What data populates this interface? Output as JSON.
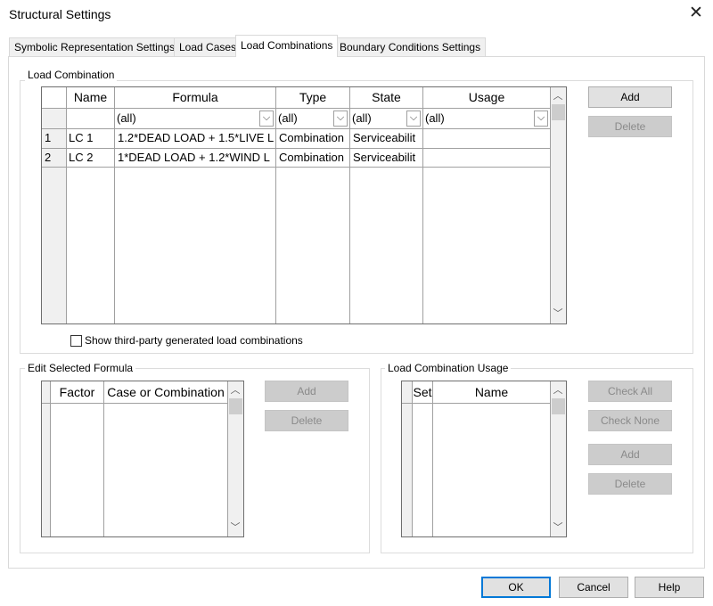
{
  "window": {
    "title": "Structural Settings"
  },
  "tabs": [
    {
      "label": "Symbolic Representation Settings"
    },
    {
      "label": "Load Cases"
    },
    {
      "label": "Load Combinations",
      "active": true
    },
    {
      "label": "Boundary Conditions Settings"
    }
  ],
  "load_combination": {
    "group_label": "Load Combination",
    "columns": [
      "Name",
      "Formula",
      "Type",
      "State",
      "Usage"
    ],
    "filter_value": "(all)",
    "rows": [
      {
        "num": "1",
        "name": "LC 1",
        "formula": "1.2*DEAD LOAD + 1.5*LIVE L",
        "type": "Combination",
        "state": "Serviceabilit",
        "usage": ""
      },
      {
        "num": "2",
        "name": "LC 2",
        "formula": "1*DEAD LOAD + 1.2*WIND L",
        "type": "Combination",
        "state": "Serviceabilit",
        "usage": ""
      }
    ],
    "add_label": "Add",
    "delete_label": "Delete",
    "show_third_party_label": "Show third-party generated load combinations",
    "show_third_party_checked": false
  },
  "edit_formula": {
    "group_label": "Edit Selected Formula",
    "columns": [
      "Factor",
      "Case or Combination"
    ],
    "add_label": "Add",
    "delete_label": "Delete"
  },
  "usage": {
    "group_label": "Load Combination Usage",
    "columns": [
      "Set",
      "Name"
    ],
    "check_all_label": "Check All",
    "check_none_label": "Check None",
    "add_label": "Add",
    "delete_label": "Delete"
  },
  "footer": {
    "ok_label": "OK",
    "cancel_label": "Cancel",
    "help_label": "Help"
  },
  "icons": {
    "close": "close-icon",
    "dropdown": "chevron-down-icon",
    "scroll_up": "chevron-up-icon",
    "scroll_down": "chevron-down-icon"
  },
  "colors": {
    "default_button_border": "#0078d7",
    "disabled_text": "#8a8a8a",
    "grid_line": "#a0a0a0"
  }
}
